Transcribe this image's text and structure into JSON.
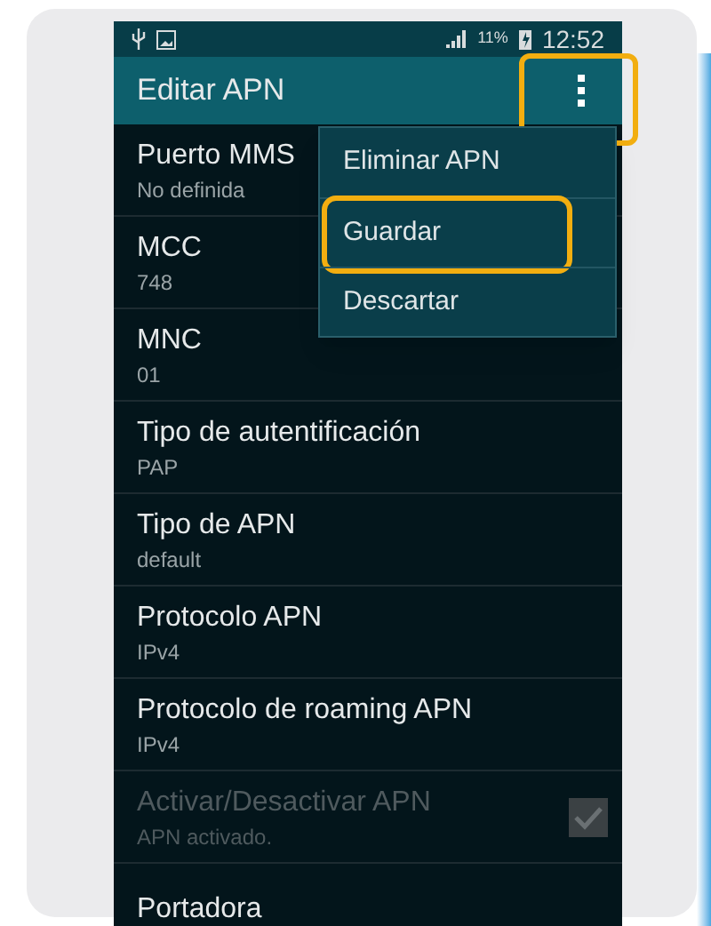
{
  "status_bar": {
    "battery": "11%",
    "time": "12:52"
  },
  "action_bar": {
    "title": "Editar APN",
    "menu_highlighted": true
  },
  "menu": {
    "items": [
      {
        "label": "Eliminar APN",
        "highlighted": false
      },
      {
        "label": "Guardar",
        "highlighted": true
      },
      {
        "label": "Descartar",
        "highlighted": false
      }
    ]
  },
  "settings": [
    {
      "kind": "text",
      "title": "Puerto MMS",
      "summary": "No definida",
      "disabled": false
    },
    {
      "kind": "text",
      "title": "MCC",
      "summary": "748",
      "disabled": false
    },
    {
      "kind": "text",
      "title": "MNC",
      "summary": "01",
      "disabled": false
    },
    {
      "kind": "text",
      "title": "Tipo de autentificación",
      "summary": "PAP",
      "disabled": false
    },
    {
      "kind": "text",
      "title": "Tipo de APN",
      "summary": "default",
      "disabled": false
    },
    {
      "kind": "text",
      "title": "Protocolo APN",
      "summary": "IPv4",
      "disabled": false
    },
    {
      "kind": "text",
      "title": "Protocolo de roaming APN",
      "summary": "IPv4",
      "disabled": false
    },
    {
      "kind": "checkbox",
      "title": "Activar/Desactivar APN",
      "summary": "APN activado.",
      "disabled": true,
      "checked": true
    },
    {
      "kind": "text",
      "title": "Portadora",
      "disabled": false
    }
  ]
}
